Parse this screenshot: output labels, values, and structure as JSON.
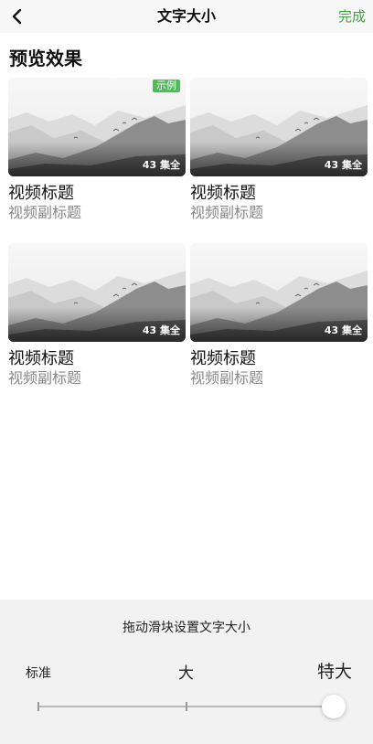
{
  "header": {
    "title": "文字大小",
    "done_label": "完成"
  },
  "preview": {
    "title": "预览效果",
    "cards": [
      {
        "badge": "示例",
        "episodes": "43 集全",
        "title": "视频标题",
        "subtitle": "视频副标题"
      },
      {
        "episodes": "43 集全",
        "title": "视频标题",
        "subtitle": "视频副标题"
      },
      {
        "episodes": "43 集全",
        "title": "视频标题",
        "subtitle": "视频副标题"
      },
      {
        "episodes": "43 集全",
        "title": "视频标题",
        "subtitle": "视频副标题"
      }
    ]
  },
  "slider": {
    "hint": "拖动滑块设置文字大小",
    "labels": {
      "standard": "标准",
      "large": "大",
      "xlarge": "特大"
    },
    "selected_index": 2,
    "stops": 3
  },
  "colors": {
    "accent": "#3aa53c",
    "badge": "#55b85b",
    "panel": "#f2f2f2"
  },
  "icons": {
    "back": "chevron-left-icon"
  }
}
